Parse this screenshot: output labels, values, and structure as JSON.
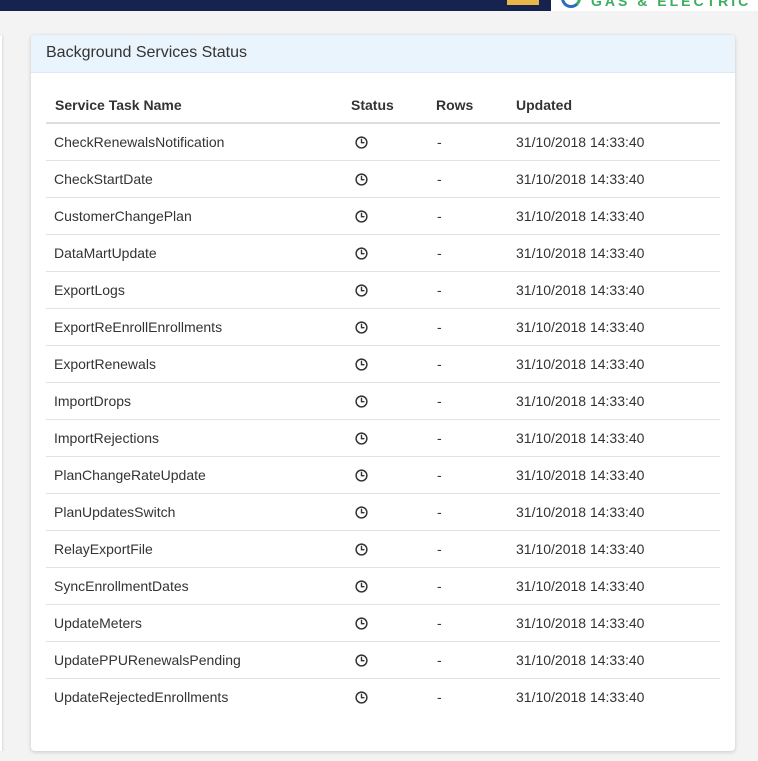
{
  "brand": {
    "logo_text": "GAS & ELECTRIC",
    "accent_color": "#e9b64a",
    "navbar_color": "#16234e",
    "logo_green": "#3cae5f",
    "logo_blue": "#2a6db8"
  },
  "card": {
    "title": "Background Services Status",
    "header_bg": "#eaf4fd"
  },
  "table": {
    "columns": [
      "Service Task Name",
      "Status",
      "Rows",
      "Updated"
    ],
    "rows": [
      {
        "name": "CheckRenewalsNotification",
        "status_icon": "clock-icon",
        "rows": "-",
        "updated": "31/10/2018 14:33:40"
      },
      {
        "name": "CheckStartDate",
        "status_icon": "clock-icon",
        "rows": "-",
        "updated": "31/10/2018 14:33:40"
      },
      {
        "name": "CustomerChangePlan",
        "status_icon": "clock-icon",
        "rows": "-",
        "updated": "31/10/2018 14:33:40"
      },
      {
        "name": "DataMartUpdate",
        "status_icon": "clock-icon",
        "rows": "-",
        "updated": "31/10/2018 14:33:40"
      },
      {
        "name": "ExportLogs",
        "status_icon": "clock-icon",
        "rows": "-",
        "updated": "31/10/2018 14:33:40"
      },
      {
        "name": "ExportReEnrollEnrollments",
        "status_icon": "clock-icon",
        "rows": "-",
        "updated": "31/10/2018 14:33:40"
      },
      {
        "name": "ExportRenewals",
        "status_icon": "clock-icon",
        "rows": "-",
        "updated": "31/10/2018 14:33:40"
      },
      {
        "name": "ImportDrops",
        "status_icon": "clock-icon",
        "rows": "-",
        "updated": "31/10/2018 14:33:40"
      },
      {
        "name": "ImportRejections",
        "status_icon": "clock-icon",
        "rows": "-",
        "updated": "31/10/2018 14:33:40"
      },
      {
        "name": "PlanChangeRateUpdate",
        "status_icon": "clock-icon",
        "rows": "-",
        "updated": "31/10/2018 14:33:40"
      },
      {
        "name": "PlanUpdatesSwitch",
        "status_icon": "clock-icon",
        "rows": "-",
        "updated": "31/10/2018 14:33:40"
      },
      {
        "name": "RelayExportFile",
        "status_icon": "clock-icon",
        "rows": "-",
        "updated": "31/10/2018 14:33:40"
      },
      {
        "name": "SyncEnrollmentDates",
        "status_icon": "clock-icon",
        "rows": "-",
        "updated": "31/10/2018 14:33:40"
      },
      {
        "name": "UpdateMeters",
        "status_icon": "clock-icon",
        "rows": "-",
        "updated": "31/10/2018 14:33:40"
      },
      {
        "name": "UpdatePPURenewalsPending",
        "status_icon": "clock-icon",
        "rows": "-",
        "updated": "31/10/2018 14:33:40"
      },
      {
        "name": "UpdateRejectedEnrollments",
        "status_icon": "clock-icon",
        "rows": "-",
        "updated": "31/10/2018 14:33:40"
      }
    ]
  }
}
